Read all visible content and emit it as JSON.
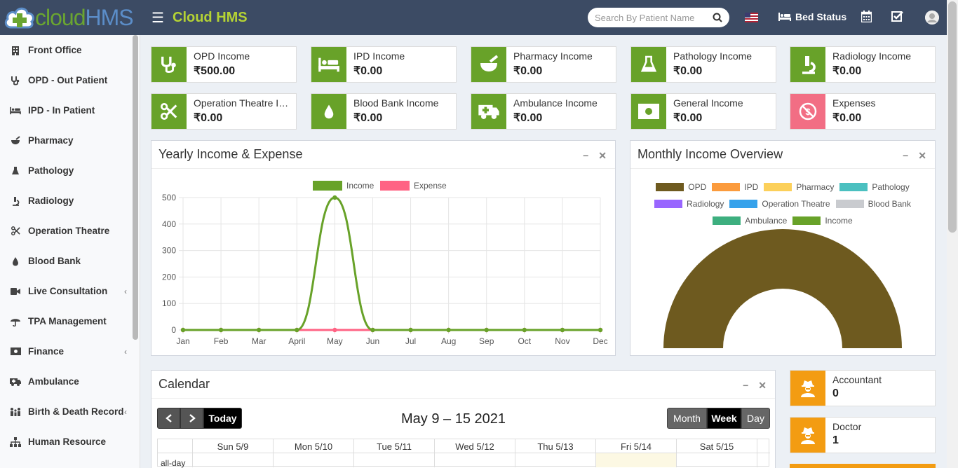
{
  "header": {
    "logo_text_1": "cloud",
    "logo_text_2": "HMS",
    "app_title": "Cloud HMS",
    "search_placeholder": "Search By Patient Name",
    "bed_status": "Bed Status",
    "icons": [
      "menu-icon",
      "search-icon",
      "us-flag-icon",
      "bed-icon",
      "calendar-icon",
      "checklist-icon",
      "user-avatar-icon"
    ]
  },
  "sidebar": {
    "items": [
      {
        "label": "Front Office",
        "icon": "building-icon",
        "chevron": false
      },
      {
        "label": "OPD - Out Patient",
        "icon": "stethoscope-icon",
        "chevron": false
      },
      {
        "label": "IPD - In Patient",
        "icon": "bed-icon",
        "chevron": false
      },
      {
        "label": "Pharmacy",
        "icon": "mortar-pestle-icon",
        "chevron": false
      },
      {
        "label": "Pathology",
        "icon": "flask-icon",
        "chevron": false
      },
      {
        "label": "Radiology",
        "icon": "microscope-icon",
        "chevron": false
      },
      {
        "label": "Operation Theatre",
        "icon": "scissors-icon",
        "chevron": false
      },
      {
        "label": "Blood Bank",
        "icon": "drop-icon",
        "chevron": false
      },
      {
        "label": "Live Consultation",
        "icon": "video-icon",
        "chevron": true
      },
      {
        "label": "TPA Management",
        "icon": "umbrella-icon",
        "chevron": false
      },
      {
        "label": "Finance",
        "icon": "money-icon",
        "chevron": true
      },
      {
        "label": "Ambulance",
        "icon": "ambulance-icon",
        "chevron": false
      },
      {
        "label": "Birth & Death Record",
        "icon": "family-icon",
        "chevron": true
      },
      {
        "label": "Human Resource",
        "icon": "sitemap-icon",
        "chevron": false
      }
    ]
  },
  "stats": [
    {
      "label": "OPD Income",
      "value": "₹500.00",
      "icon": "stethoscope-icon",
      "color": "#68a229"
    },
    {
      "label": "IPD Income",
      "value": "₹0.00",
      "icon": "bed-icon",
      "color": "#68a229"
    },
    {
      "label": "Pharmacy Income",
      "value": "₹0.00",
      "icon": "mortar-pestle-icon",
      "color": "#68a229"
    },
    {
      "label": "Pathology Income",
      "value": "₹0.00",
      "icon": "flask-icon",
      "color": "#68a229"
    },
    {
      "label": "Radiology Income",
      "value": "₹0.00",
      "icon": "microscope-icon",
      "color": "#68a229"
    },
    {
      "label": "Operation Theatre Income",
      "value": "₹0.00",
      "icon": "scissors-icon",
      "color": "#68a229"
    },
    {
      "label": "Blood Bank Income",
      "value": "₹0.00",
      "icon": "drop-icon",
      "color": "#68a229"
    },
    {
      "label": "Ambulance Income",
      "value": "₹0.00",
      "icon": "ambulance-icon",
      "color": "#68a229"
    },
    {
      "label": "General Income",
      "value": "₹0.00",
      "icon": "money-icon",
      "color": "#68a229"
    },
    {
      "label": "Expenses",
      "value": "₹0.00",
      "icon": "no-money-icon",
      "color": "#f26e84"
    }
  ],
  "yearly_panel": {
    "title": "Yearly Income & Expense"
  },
  "monthly_panel": {
    "title": "Monthly Income Overview"
  },
  "chart_data": [
    {
      "type": "line",
      "x": [
        "Jan",
        "Feb",
        "Mar",
        "April",
        "May",
        "Jun",
        "Jul",
        "Aug",
        "Sep",
        "Oct",
        "Nov",
        "Dec"
      ],
      "series": [
        {
          "name": "Income",
          "color": "#68a229",
          "values": [
            0,
            0,
            0,
            0,
            500,
            0,
            0,
            0,
            0,
            0,
            0,
            0
          ]
        },
        {
          "name": "Expense",
          "color": "#ff6384",
          "values": [
            0,
            0,
            0,
            0,
            0,
            0,
            0,
            0,
            0,
            0,
            0,
            0
          ]
        }
      ],
      "ylim": [
        0,
        500
      ],
      "yticks": [
        0,
        100,
        200,
        300,
        400,
        500
      ],
      "legend": "top",
      "grid": true
    },
    {
      "type": "pie",
      "subtype": "half-doughnut",
      "categories": [
        "OPD",
        "IPD",
        "Pharmacy",
        "Pathology",
        "Radiology",
        "Operation Theatre",
        "Blood Bank",
        "Ambulance",
        "Income"
      ],
      "colors": [
        "#6e5a1f",
        "#fb9b3d",
        "#fcd05a",
        "#4bc0c0",
        "#9966ff",
        "#36a2eb",
        "#c9cbcf",
        "#3daf7f",
        "#68a229"
      ],
      "values": [
        500,
        0,
        0,
        0,
        0,
        0,
        0,
        0,
        0
      ],
      "legend": "top"
    }
  ],
  "calendar": {
    "title": "Calendar",
    "range": "May 9 – 15 2021",
    "today": "Today",
    "views": [
      "Month",
      "Week",
      "Day"
    ],
    "active_view": "Week",
    "days": [
      "Sun 5/9",
      "Mon 5/10",
      "Tue 5/11",
      "Wed 5/12",
      "Thu 5/13",
      "Fri 5/14",
      "Sat 5/15"
    ],
    "allday": "all-day"
  },
  "staff": [
    {
      "label": "Accountant",
      "value": "0",
      "icon": "user-secret-icon",
      "color": "#f39c12"
    },
    {
      "label": "Doctor",
      "value": "1",
      "icon": "user-secret-icon",
      "color": "#f39c12"
    }
  ]
}
